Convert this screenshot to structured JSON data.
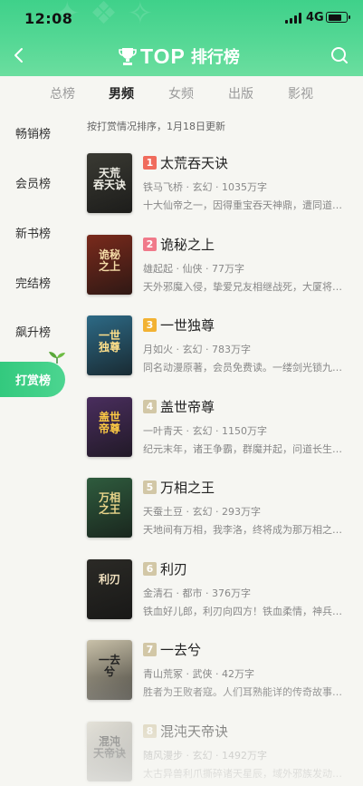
{
  "status_bar": {
    "time": "12:08",
    "network": "4G",
    "battery_level": 0.8
  },
  "header": {
    "title_main": "TOP",
    "title_sub": "排行榜",
    "back_icon": "chevron-left-icon",
    "search_icon": "search-icon",
    "accent": "#3fd18a"
  },
  "tabs": [
    {
      "label": "总榜",
      "active": false
    },
    {
      "label": "男频",
      "active": true
    },
    {
      "label": "女频",
      "active": false
    },
    {
      "label": "出版",
      "active": false
    },
    {
      "label": "影视",
      "active": false
    }
  ],
  "sidebar": {
    "items": [
      {
        "label": "畅销榜"
      },
      {
        "label": "会员榜"
      },
      {
        "label": "新书榜"
      },
      {
        "label": "完结榜"
      },
      {
        "label": "飙升榜"
      },
      {
        "label": "打赏榜",
        "active": true
      }
    ]
  },
  "main": {
    "sort_note": "按打赏情况排序，1月18日更新",
    "books": [
      {
        "rank": "1",
        "title": "太荒吞天诀",
        "meta": "铁马飞桥 · 玄幻 · 1035万字",
        "desc": "十大仙帝之一，因得重宝吞天神鼎，遭同道围攻……",
        "cover_text": "天荒\n吞天诀",
        "cover_bg": "#3a3a33",
        "cover_fg": "#f0efe6",
        "rank_color": "#f06b5c"
      },
      {
        "rank": "2",
        "title": "诡秘之上",
        "meta": "雄起起 · 仙侠 · 77万字",
        "desc": "天外邪魔入侵，挚爱兄友相继战死，大厦将倾……",
        "cover_text": "诡秘\n之上",
        "cover_bg": "#7a2a1c",
        "cover_fg": "#f3d9a6",
        "rank_color": "#f07a8a"
      },
      {
        "rank": "3",
        "title": "一世独尊",
        "meta": "月如火 · 玄幻 · 783万字",
        "desc": "同名动漫原著，会员免费读。一缕剑光锁九州……",
        "cover_text": "一世\n独尊",
        "cover_bg": "#2d6a86",
        "cover_fg": "#ffe08a",
        "rank_color": "#f2b233"
      },
      {
        "rank": "4",
        "title": "盖世帝尊",
        "meta": "一叶青天 · 玄幻 · 1150万字",
        "desc": "纪元末年，诸王争霸，群魔并起，问道长生……",
        "cover_text": "盖世\n帝尊",
        "cover_bg": "#4a2e5e",
        "cover_fg": "#ffcc44",
        "rank_color": "#d2c7a6"
      },
      {
        "rank": "5",
        "title": "万相之王",
        "meta": "天蚕土豆 · 玄幻 · 293万字",
        "desc": "天地间有万相，我李洛，终将成为那万相之王……",
        "cover_text": "万相\n之王",
        "cover_bg": "#2f5c3e",
        "cover_fg": "#e8d48a",
        "rank_color": "#d2c7a6"
      },
      {
        "rank": "6",
        "title": "利刃",
        "meta": "金清石 · 都市 · 376万字",
        "desc": "铁血好儿郎，利刃向四方！铁血柔情，神兵利刃……",
        "cover_text": "利刃",
        "cover_bg": "#2b2a26",
        "cover_fg": "#f2e2c0",
        "rank_color": "#d2c7a6"
      },
      {
        "rank": "7",
        "title": "一去兮",
        "meta": "青山荒冢 · 武侠 · 42万字",
        "desc": "胜者为王败者寇。人们耳熟能详的传奇故事……",
        "cover_text": "一去\n兮",
        "cover_bg": "#c9c1a9",
        "cover_fg": "#222222",
        "rank_color": "#d2c7a6"
      },
      {
        "rank": "8",
        "title": "混沌天帝诀",
        "meta": "随风漫步 · 玄幻 · 1492万字",
        "desc": "太古异兽利爪撕碎诸天星辰，域外邪族发动入侵……",
        "cover_text": "混沌\n天帝诀",
        "cover_bg": "#d9d5c8",
        "cover_fg": "#222222",
        "rank_color": "#d2c7a6"
      }
    ]
  }
}
